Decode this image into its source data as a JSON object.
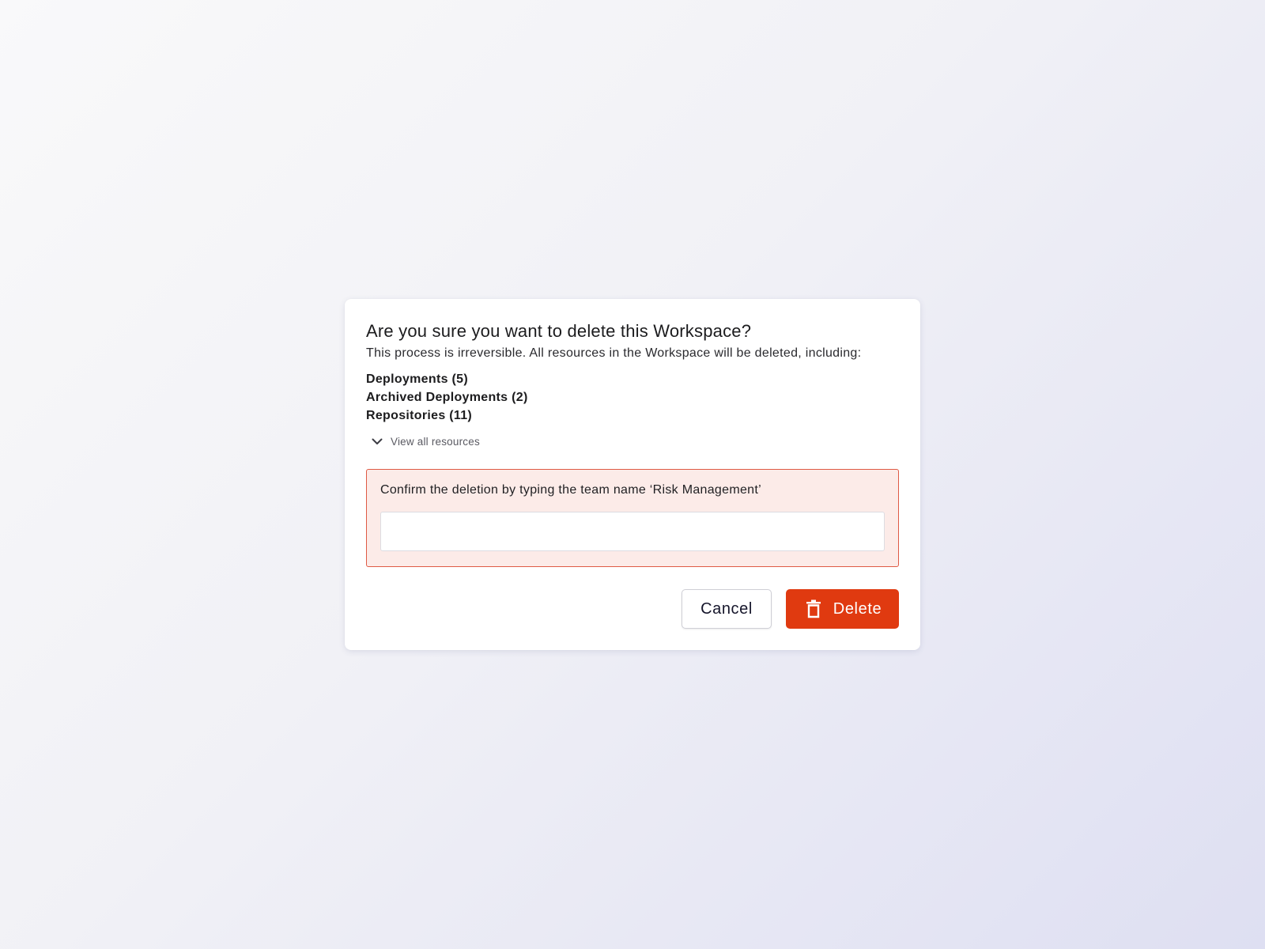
{
  "dialog": {
    "title": "Are you sure you want to delete this Workspace?",
    "subtitle": "This process is irreversible. All resources in the Workspace will be deleted, including:",
    "resources": [
      "Deployments (5)",
      "Archived Deployments (2)",
      "Repositories (11)"
    ],
    "view_all": {
      "label": "View all resources",
      "icon": "chevron-down-icon"
    },
    "confirm": {
      "label": "Confirm the deletion by typing the team name ‘Risk Management’",
      "value": "",
      "placeholder": ""
    },
    "actions": {
      "cancel_label": "Cancel",
      "delete_label": "Delete",
      "delete_icon": "trash-icon"
    }
  },
  "colors": {
    "danger": "#e03a10",
    "danger_border": "#df5a45",
    "danger_bg": "#fcebe8"
  }
}
